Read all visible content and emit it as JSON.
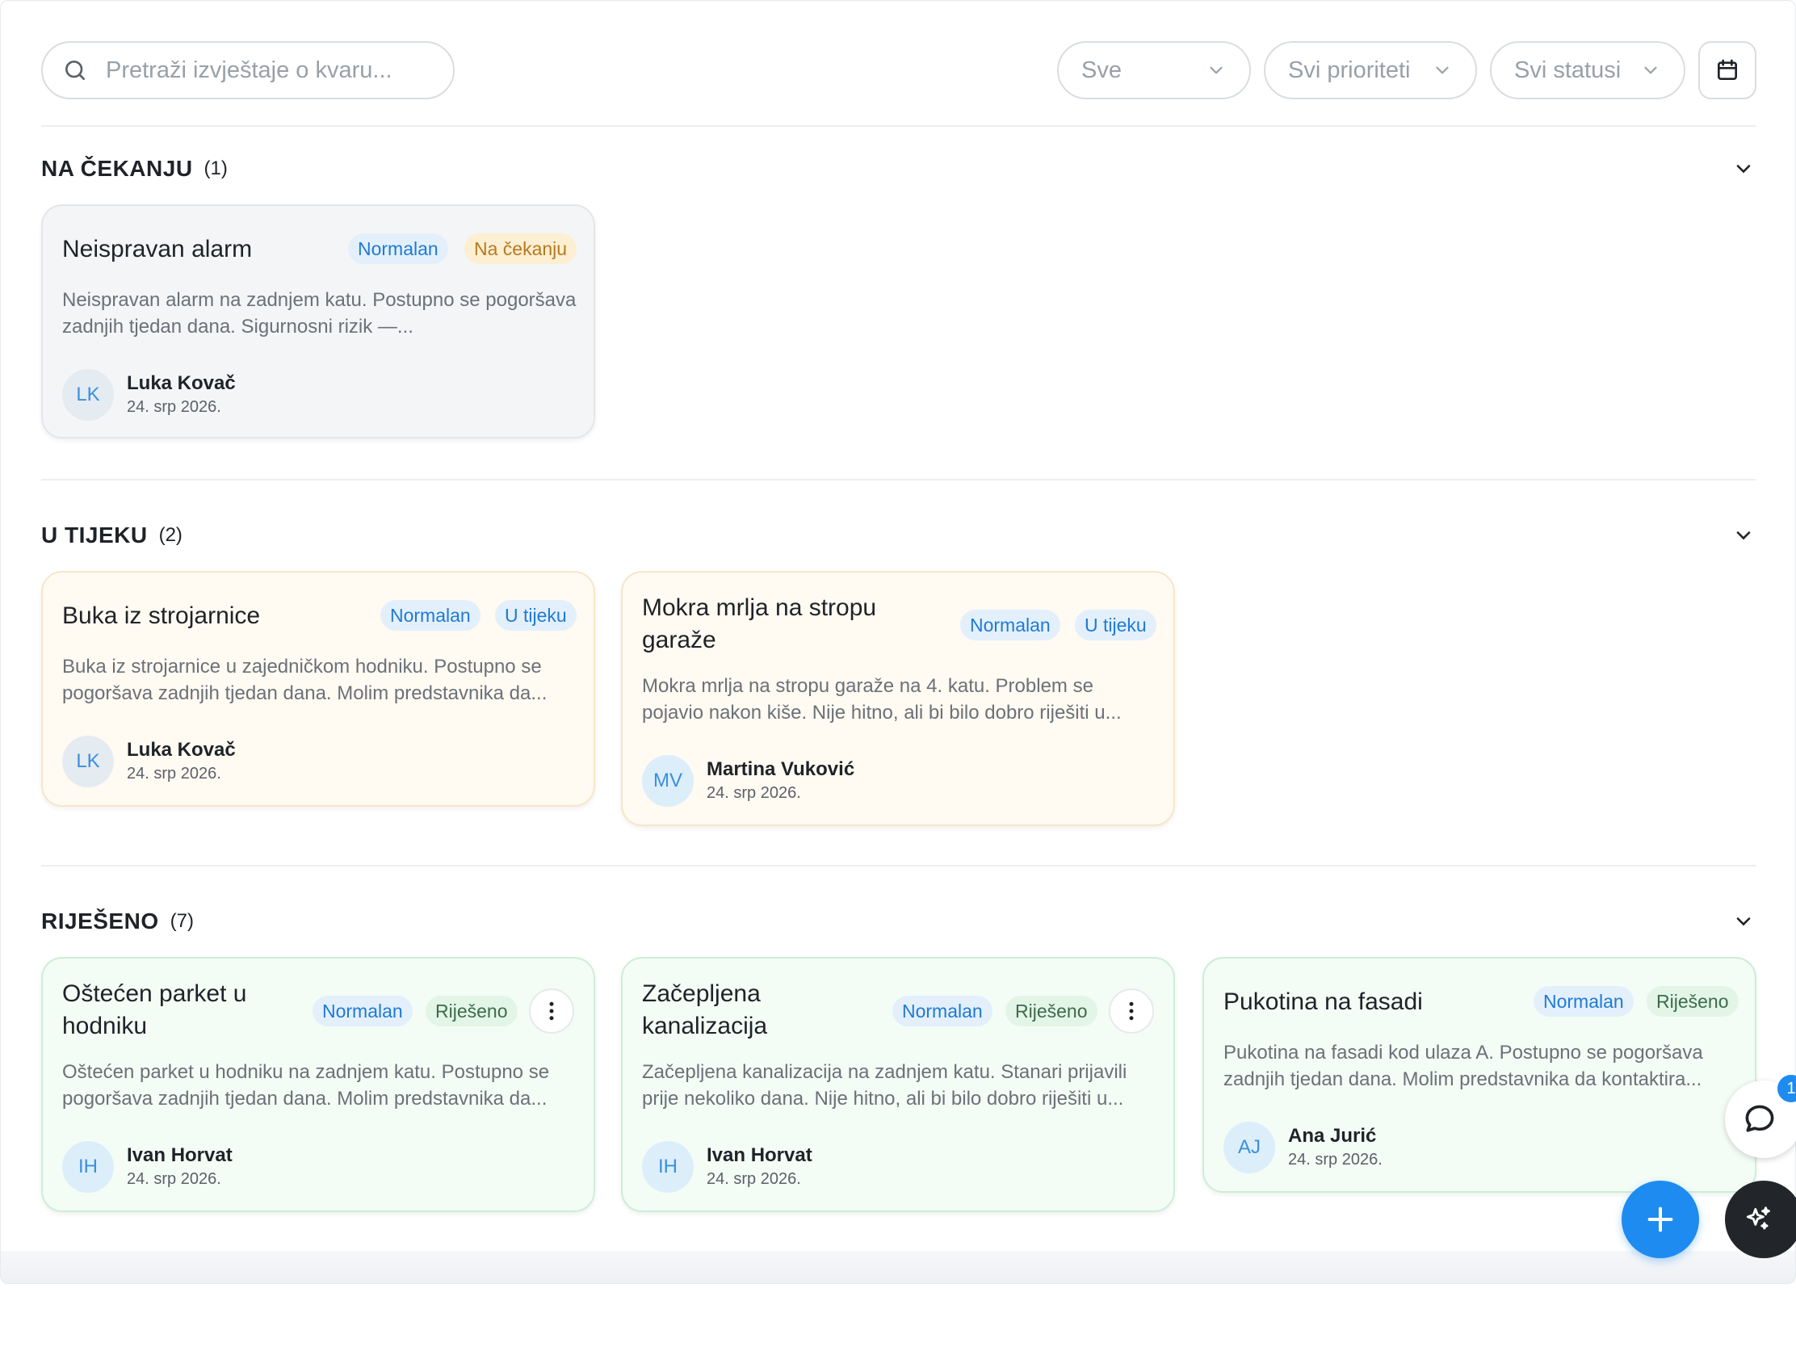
{
  "search": {
    "placeholder": "Pretraži izvještaje o kvaru..."
  },
  "filters": {
    "category": "Sve",
    "priority": "Svi prioriteti",
    "status": "Svi statusi"
  },
  "icons": {
    "search": "search-icon",
    "chevron": "chevron-down-icon",
    "calendar": "calendar-icon",
    "more": "more-vertical-icon",
    "chat": "chat-icon",
    "add": "plus-icon",
    "ai": "sparkles-icon"
  },
  "colors": {
    "accent": "#1e8bf0",
    "pending_card": "#f4f5f7",
    "progress_card": "#fffaf2",
    "resolved_card": "#f3fcf5"
  },
  "sections": [
    {
      "title": "NA ČEKANJU",
      "count": "(1)",
      "cards": [
        {
          "title": "Neispravan alarm",
          "priority": "Normalan",
          "status": "Na čekanju",
          "description": "Neispravan alarm na zadnjem katu. Postupno se pogoršava zadnjih tjedan dana. Sigurnosni rizik —...",
          "initials": "LK",
          "author": "Luka Kovač",
          "date": "24. srp 2026."
        }
      ]
    },
    {
      "title": "U TIJEKU",
      "count": "(2)",
      "cards": [
        {
          "title": "Buka iz strojarnice",
          "priority": "Normalan",
          "status": "U tijeku",
          "description": "Buka iz strojarnice u zajedničkom hodniku. Postupno se pogoršava zadnjih tjedan dana. Molim predstavnika da...",
          "initials": "LK",
          "author": "Luka Kovač",
          "date": "24. srp 2026."
        },
        {
          "title": "Mokra mrlja na stropu garaže",
          "priority": "Normalan",
          "status": "U tijeku",
          "description": "Mokra mrlja na stropu garaže na 4. katu. Problem se pojavio nakon kiše. Nije hitno, ali bi bilo dobro riješiti u...",
          "initials": "MV",
          "author": "Martina Vuković",
          "date": "24. srp 2026."
        }
      ]
    },
    {
      "title": "RIJEŠENO",
      "count": "(7)",
      "cards": [
        {
          "title": "Oštećen parket u hodniku",
          "priority": "Normalan",
          "status": "Riješeno",
          "description": "Oštećen parket u hodniku na zadnjem katu. Postupno se pogoršava zadnjih tjedan dana. Molim predstavnika da...",
          "initials": "IH",
          "author": "Ivan Horvat",
          "date": "24. srp 2026."
        },
        {
          "title": "Začepljena kanalizacija",
          "priority": "Normalan",
          "status": "Riješeno",
          "description": "Začepljena kanalizacija na zadnjem katu. Stanari prijavili prije nekoliko dana. Nije hitno, ali bi bilo dobro riješiti u...",
          "initials": "IH",
          "author": "Ivan Horvat",
          "date": "24. srp 2026."
        },
        {
          "title": "Pukotina na fasadi",
          "priority": "Normalan",
          "status": "Riješeno",
          "description": "Pukotina na fasadi kod ulaza A. Postupno se pogoršava zadnjih tjedan dana. Molim predstavnika da kontaktira...",
          "initials": "AJ",
          "author": "Ana Jurić",
          "date": "24. srp 2026."
        }
      ]
    }
  ],
  "chat_badge": "1"
}
